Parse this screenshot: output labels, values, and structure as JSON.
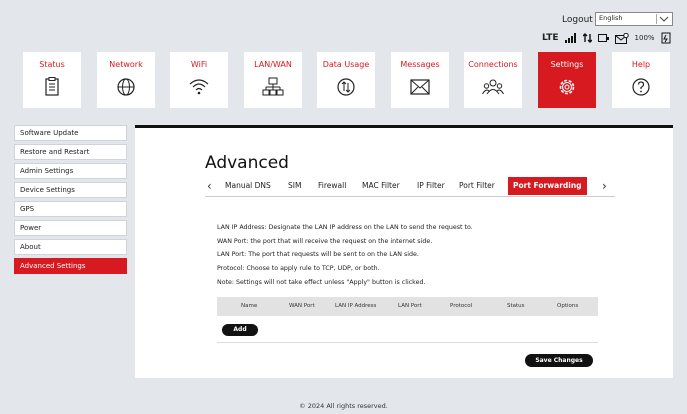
{
  "header": {
    "logout": "Logout",
    "language": "English",
    "network_type": "LTE",
    "battery": "100%"
  },
  "nav": [
    {
      "label": "Status",
      "icon": "clipboard-icon"
    },
    {
      "label": "Network",
      "icon": "globe-icon"
    },
    {
      "label": "WiFi",
      "icon": "wifi-icon"
    },
    {
      "label": "LAN/WAN",
      "icon": "lan-icon"
    },
    {
      "label": "Data Usage",
      "icon": "data-usage-icon"
    },
    {
      "label": "Messages",
      "icon": "envelope-icon"
    },
    {
      "label": "Connections",
      "icon": "users-icon"
    },
    {
      "label": "Settings",
      "icon": "gear-icon"
    },
    {
      "label": "Help",
      "icon": "help-icon"
    }
  ],
  "sidebar": [
    {
      "label": "Software Update"
    },
    {
      "label": "Restore and Restart"
    },
    {
      "label": "Admin Settings"
    },
    {
      "label": "Device Settings"
    },
    {
      "label": "GPS"
    },
    {
      "label": "Power"
    },
    {
      "label": "About"
    },
    {
      "label": "Advanced Settings"
    }
  ],
  "main": {
    "title": "Advanced",
    "tabs": [
      {
        "label": "Manual DNS"
      },
      {
        "label": "SIM"
      },
      {
        "label": "Firewall"
      },
      {
        "label": "MAC Filter"
      },
      {
        "label": "IP Filter"
      },
      {
        "label": "Port Filter"
      },
      {
        "label": "Port Forwarding"
      }
    ],
    "info": [
      "LAN IP Address: Designate the LAN IP address on the LAN to send the request to.",
      "WAN Port: the port that will receive the request on the internet side.",
      "LAN Port: The port that requests will be sent to on the LAN side.",
      "Protocol: Choose to apply rule to TCP, UDP, or both.",
      "Note: Settings will not take effect unless \"Apply\" button is clicked."
    ],
    "columns": [
      "Name",
      "WAN Port",
      "LAN IP Address",
      "LAN Port",
      "Protocol",
      "Status",
      "Options"
    ],
    "add_label": "Add",
    "save_label": "Save Changes"
  },
  "footer": "© 2024 All rights reserved.",
  "colors": {
    "accent": "#d71920",
    "background": "#e3e6ea"
  }
}
